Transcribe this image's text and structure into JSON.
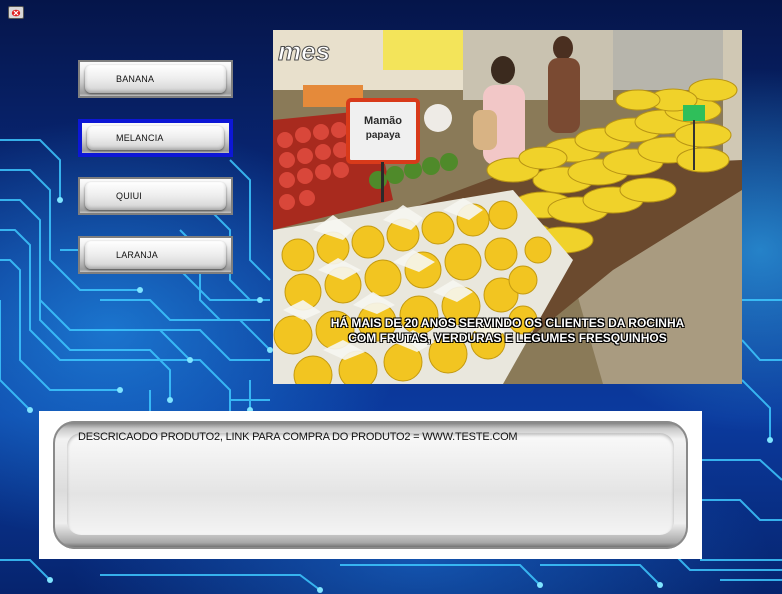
{
  "window": {
    "close_icon": "close-icon"
  },
  "menu": {
    "items": [
      {
        "label": "BANANA",
        "selected": false
      },
      {
        "label": "MELANCIA",
        "selected": true
      },
      {
        "label": "QUIUI",
        "selected": false
      },
      {
        "label": "LARANJA",
        "selected": false
      }
    ]
  },
  "video": {
    "sign_text_line1": "Mamão",
    "sign_text_line2": "papaya",
    "store_sign": "mes",
    "caption_line1": "HÁ MAIS DE 20 ANOS SERVINDO OS CLIENTES DA ROCINHA",
    "caption_line2": "COM FRUTAS, VERDURAS E LEGUMES FRESQUINHOS"
  },
  "description": {
    "text": "DESCRICAODO PRODUTO2, LINK PARA COMPRA DO PRODUTO2 = WWW.TESTE.COM"
  },
  "colors": {
    "background": "#0a2f8a",
    "selected_border": "#0d17d6",
    "circuit": "#39c6ff"
  }
}
